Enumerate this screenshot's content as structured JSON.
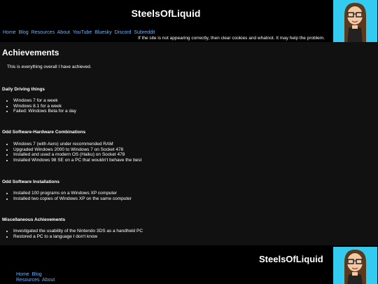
{
  "site": {
    "title": "SteelsOfLiquid"
  },
  "nav": {
    "links": [
      "Home",
      "Blog",
      "Resources",
      "About",
      "YouTube",
      "Bluesky",
      "Discord",
      "Subreddit"
    ],
    "notice": "If the site is not appearing correctly, then clear cookies and whatnot. It may help the problem."
  },
  "page": {
    "title": "Achievements",
    "intro": "This is everything overall I have achieved."
  },
  "sections": [
    {
      "heading": "Daily Driving things",
      "items": [
        "Windows 7 for a week",
        "Windows 8.1 for a week",
        "Failed: Windows Beta for a day"
      ]
    },
    {
      "heading": "Odd Software-Hardware Combinations",
      "items": [
        "Windows 7 (with Aero) under recommended RAM",
        "Upgraded Windows 2000 to Windows 7 on Socket 478",
        "Installed and used a modern OS (Haiku) on Socket 478",
        "Installed Windows 98 SE on a PC that wouldn't behave the best"
      ]
    },
    {
      "heading": "Odd Software Installations",
      "items": [
        "Installed 100 programs on a Windows XP computer",
        "Installed two copies of Windows XP on the same computer"
      ]
    },
    {
      "heading": "Miscellaneous Achievements",
      "items": [
        "Investigated the usability of the Nintendo 3DS as a handheld PC",
        "Restored a PC to a language I don't know"
      ]
    }
  ],
  "footer": {
    "title": "SteelsOfLiquid",
    "links_row1": [
      "Home",
      "Blog"
    ],
    "links_row2": [
      "Resources",
      "About"
    ]
  },
  "colors": {
    "link": "#66b3ff",
    "avatar_bg": "#33ccf0",
    "content_bg": "#111111"
  },
  "icons": {
    "avatar": "avatar-girl-glasses"
  }
}
